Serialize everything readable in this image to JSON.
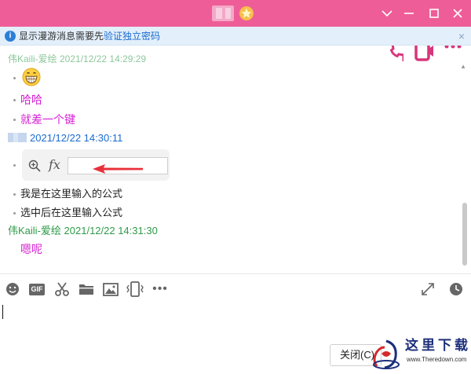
{
  "window": {
    "title_icon": "star-icon",
    "controls": [
      "chevron-down-icon",
      "minimize-icon",
      "maximize-icon",
      "close-icon"
    ]
  },
  "notice": {
    "text": "显示漫游消息需要先",
    "link": "验证独立密码",
    "close": "×"
  },
  "chat": {
    "partial_header": "伟Kaili-爱绘 2021/12/22 14:29:29",
    "messages": [
      {
        "type": "emoji",
        "icon": "grinning-face-emoji"
      },
      {
        "type": "text",
        "text": "哈哈"
      },
      {
        "type": "text",
        "text": "就差一个键"
      }
    ],
    "sender2": {
      "time": "2021/12/22 14:30:11"
    },
    "messages2": [
      {
        "type": "formula-widget",
        "fx_label": "fx",
        "zoom_icon": "zoom-in-icon"
      },
      {
        "type": "text",
        "text": "我是在这里输入的公式"
      },
      {
        "type": "text",
        "text": "选中后在这里输入公式"
      }
    ],
    "sender3": {
      "name": "伟Kaili-爱绘",
      "time": "2021/12/22 14:31:30"
    },
    "messages3": [
      {
        "type": "text",
        "text": "嗯呢"
      }
    ]
  },
  "toolbar": {
    "gif_label": "GIF",
    "more_label": "•••",
    "icons": [
      "emoji-icon",
      "gif-icon",
      "scissors-icon",
      "folder-icon",
      "image-icon",
      "shake-icon",
      "more-icon",
      "expand-icon",
      "history-icon"
    ]
  },
  "input": {
    "close_label": "关闭(C)"
  },
  "watermark": {
    "title": "这里下载",
    "url": "www.Theredown.com"
  },
  "colors": {
    "titlebar": "#ee5d98",
    "notice_bg": "#e3effa",
    "link": "#1a6bd1",
    "sender_green": "#2e9a48",
    "message_pink": "#d61fd4",
    "arrow_red": "#e8303a"
  }
}
